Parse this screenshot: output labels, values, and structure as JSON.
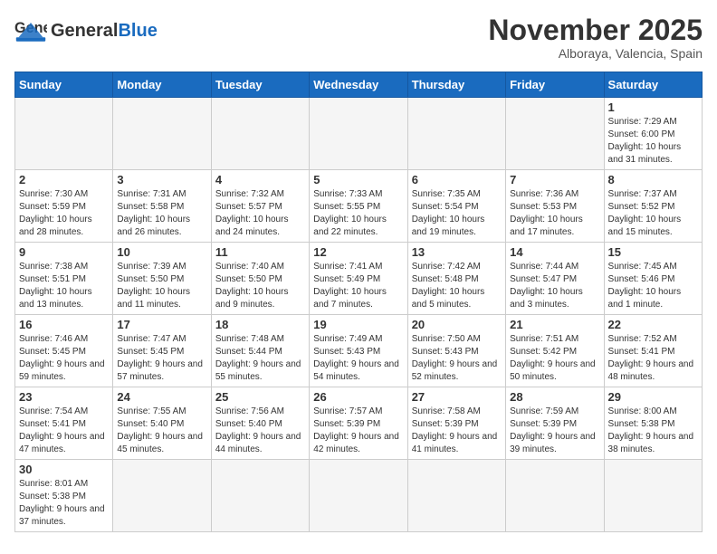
{
  "header": {
    "logo_general": "General",
    "logo_blue": "Blue",
    "month_year": "November 2025",
    "location": "Alboraya, Valencia, Spain"
  },
  "weekdays": [
    "Sunday",
    "Monday",
    "Tuesday",
    "Wednesday",
    "Thursday",
    "Friday",
    "Saturday"
  ],
  "weeks": [
    [
      {
        "day": "",
        "info": ""
      },
      {
        "day": "",
        "info": ""
      },
      {
        "day": "",
        "info": ""
      },
      {
        "day": "",
        "info": ""
      },
      {
        "day": "",
        "info": ""
      },
      {
        "day": "",
        "info": ""
      },
      {
        "day": "1",
        "info": "Sunrise: 7:29 AM\nSunset: 6:00 PM\nDaylight: 10 hours and 31 minutes."
      }
    ],
    [
      {
        "day": "2",
        "info": "Sunrise: 7:30 AM\nSunset: 5:59 PM\nDaylight: 10 hours and 28 minutes."
      },
      {
        "day": "3",
        "info": "Sunrise: 7:31 AM\nSunset: 5:58 PM\nDaylight: 10 hours and 26 minutes."
      },
      {
        "day": "4",
        "info": "Sunrise: 7:32 AM\nSunset: 5:57 PM\nDaylight: 10 hours and 24 minutes."
      },
      {
        "day": "5",
        "info": "Sunrise: 7:33 AM\nSunset: 5:55 PM\nDaylight: 10 hours and 22 minutes."
      },
      {
        "day": "6",
        "info": "Sunrise: 7:35 AM\nSunset: 5:54 PM\nDaylight: 10 hours and 19 minutes."
      },
      {
        "day": "7",
        "info": "Sunrise: 7:36 AM\nSunset: 5:53 PM\nDaylight: 10 hours and 17 minutes."
      },
      {
        "day": "8",
        "info": "Sunrise: 7:37 AM\nSunset: 5:52 PM\nDaylight: 10 hours and 15 minutes."
      }
    ],
    [
      {
        "day": "9",
        "info": "Sunrise: 7:38 AM\nSunset: 5:51 PM\nDaylight: 10 hours and 13 minutes."
      },
      {
        "day": "10",
        "info": "Sunrise: 7:39 AM\nSunset: 5:50 PM\nDaylight: 10 hours and 11 minutes."
      },
      {
        "day": "11",
        "info": "Sunrise: 7:40 AM\nSunset: 5:50 PM\nDaylight: 10 hours and 9 minutes."
      },
      {
        "day": "12",
        "info": "Sunrise: 7:41 AM\nSunset: 5:49 PM\nDaylight: 10 hours and 7 minutes."
      },
      {
        "day": "13",
        "info": "Sunrise: 7:42 AM\nSunset: 5:48 PM\nDaylight: 10 hours and 5 minutes."
      },
      {
        "day": "14",
        "info": "Sunrise: 7:44 AM\nSunset: 5:47 PM\nDaylight: 10 hours and 3 minutes."
      },
      {
        "day": "15",
        "info": "Sunrise: 7:45 AM\nSunset: 5:46 PM\nDaylight: 10 hours and 1 minute."
      }
    ],
    [
      {
        "day": "16",
        "info": "Sunrise: 7:46 AM\nSunset: 5:45 PM\nDaylight: 9 hours and 59 minutes."
      },
      {
        "day": "17",
        "info": "Sunrise: 7:47 AM\nSunset: 5:45 PM\nDaylight: 9 hours and 57 minutes."
      },
      {
        "day": "18",
        "info": "Sunrise: 7:48 AM\nSunset: 5:44 PM\nDaylight: 9 hours and 55 minutes."
      },
      {
        "day": "19",
        "info": "Sunrise: 7:49 AM\nSunset: 5:43 PM\nDaylight: 9 hours and 54 minutes."
      },
      {
        "day": "20",
        "info": "Sunrise: 7:50 AM\nSunset: 5:43 PM\nDaylight: 9 hours and 52 minutes."
      },
      {
        "day": "21",
        "info": "Sunrise: 7:51 AM\nSunset: 5:42 PM\nDaylight: 9 hours and 50 minutes."
      },
      {
        "day": "22",
        "info": "Sunrise: 7:52 AM\nSunset: 5:41 PM\nDaylight: 9 hours and 48 minutes."
      }
    ],
    [
      {
        "day": "23",
        "info": "Sunrise: 7:54 AM\nSunset: 5:41 PM\nDaylight: 9 hours and 47 minutes."
      },
      {
        "day": "24",
        "info": "Sunrise: 7:55 AM\nSunset: 5:40 PM\nDaylight: 9 hours and 45 minutes."
      },
      {
        "day": "25",
        "info": "Sunrise: 7:56 AM\nSunset: 5:40 PM\nDaylight: 9 hours and 44 minutes."
      },
      {
        "day": "26",
        "info": "Sunrise: 7:57 AM\nSunset: 5:39 PM\nDaylight: 9 hours and 42 minutes."
      },
      {
        "day": "27",
        "info": "Sunrise: 7:58 AM\nSunset: 5:39 PM\nDaylight: 9 hours and 41 minutes."
      },
      {
        "day": "28",
        "info": "Sunrise: 7:59 AM\nSunset: 5:39 PM\nDaylight: 9 hours and 39 minutes."
      },
      {
        "day": "29",
        "info": "Sunrise: 8:00 AM\nSunset: 5:38 PM\nDaylight: 9 hours and 38 minutes."
      }
    ],
    [
      {
        "day": "30",
        "info": "Sunrise: 8:01 AM\nSunset: 5:38 PM\nDaylight: 9 hours and 37 minutes."
      },
      {
        "day": "",
        "info": ""
      },
      {
        "day": "",
        "info": ""
      },
      {
        "day": "",
        "info": ""
      },
      {
        "day": "",
        "info": ""
      },
      {
        "day": "",
        "info": ""
      },
      {
        "day": "",
        "info": ""
      }
    ]
  ]
}
